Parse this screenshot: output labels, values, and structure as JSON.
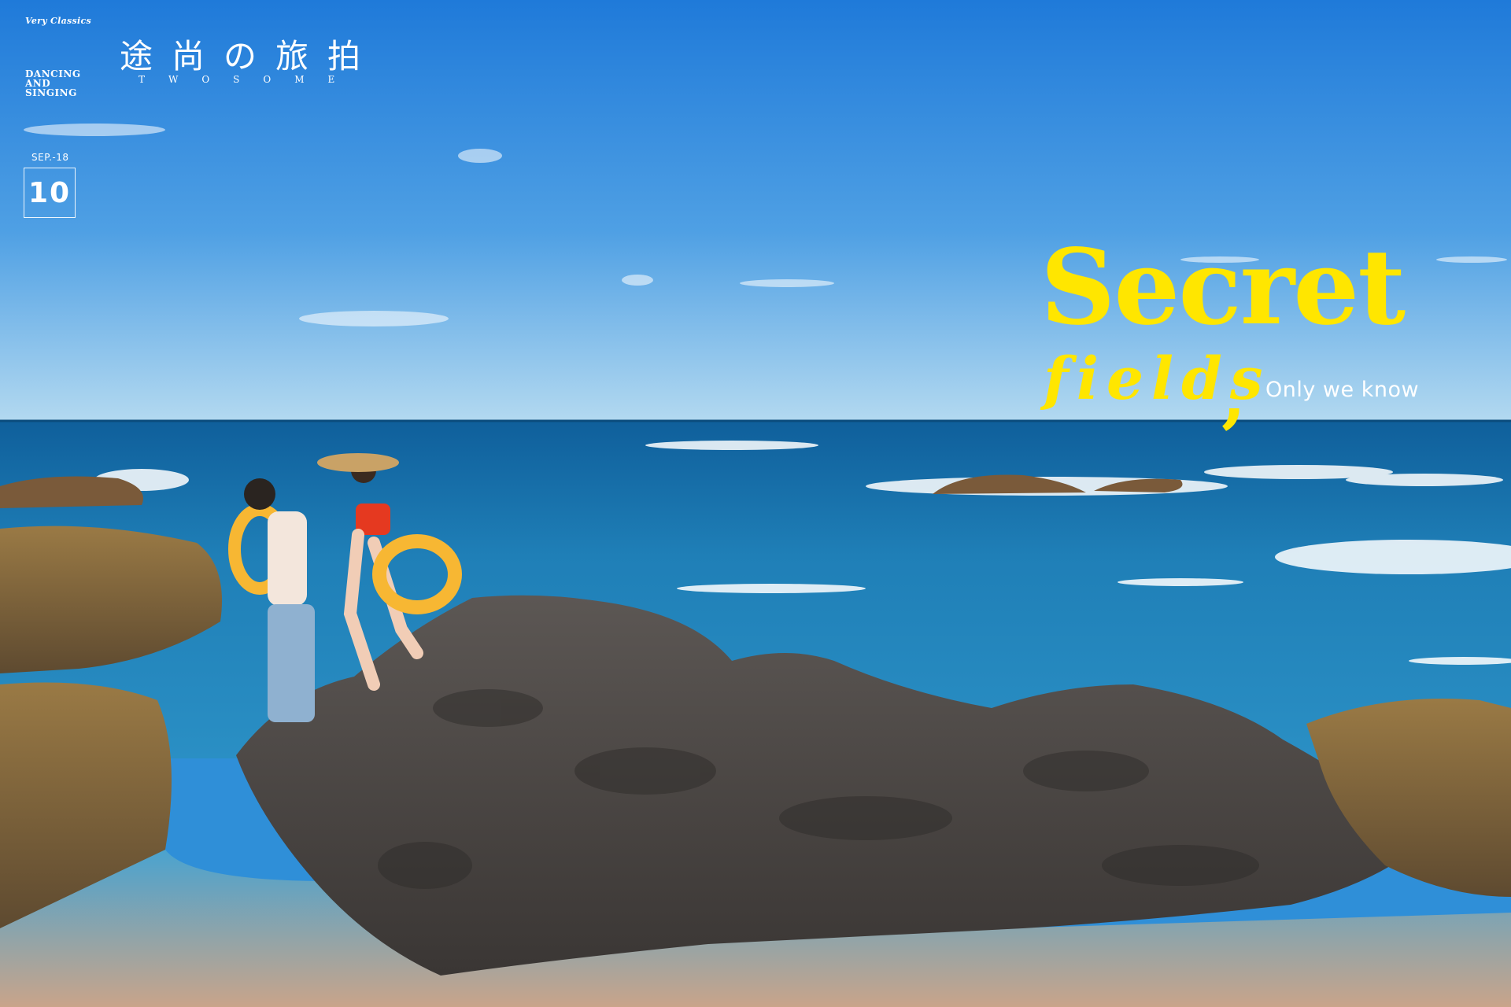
{
  "brand": {
    "small_title": "Very Classics",
    "stack_lines": [
      "DANCING",
      "AND",
      "SINGING"
    ],
    "title_cn": "途尚の旅拍",
    "subtitle": "TWOSOME"
  },
  "date": {
    "label": "SEP.-18",
    "day": "10"
  },
  "headline": {
    "line1": "Secret",
    "line2": "fields",
    "comma": ",",
    "tagline": "Only we know"
  },
  "colors": {
    "sky_top": "#1f7fdc",
    "sky_horizon": "#a9d3ee",
    "sea": "#1b6fa8",
    "rock": "#4c4844",
    "accent_yellow": "#ffe600",
    "float_ring": "#f7b733"
  }
}
